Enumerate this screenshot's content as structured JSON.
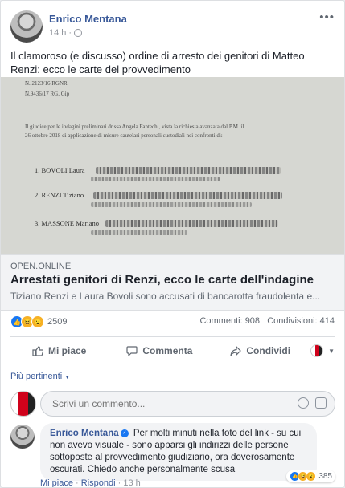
{
  "post": {
    "author": "Enrico Mentana",
    "time": "14 h",
    "more": "•••",
    "text": "Il clamoroso (e discusso) ordine di arresto dei genitori di Matteo Renzi: ecco le carte del provvedimento"
  },
  "document_image": {
    "line1": "N. 2123/16 RGNR",
    "line2": "N.9436/17 RG. Gip",
    "line3": "Il giudice per le indagini preliminari dr.ssa Angela Fantechi, vista la richiesta avanzata dal P.M. il",
    "line4": "26 ottobre 2018 di applicazione di misure cautelari personali custodiali nei confronti di:",
    "name1": "1. BOVOLI Laura",
    "name2": "2. RENZI Tiziano",
    "name3": "3. MASSONE Mariano"
  },
  "link": {
    "domain": "OPEN.ONLINE",
    "title": "Arrestati genitori di Renzi, ecco le carte dell'indagine",
    "description": "Tiziano Renzi e Laura Bovoli sono accusati di bancarotta fraudolenta e..."
  },
  "stats": {
    "reactions": "2509",
    "comments": "Commenti: 908",
    "shares": "Condivisioni: 414"
  },
  "actions": {
    "like": "Mi piace",
    "comment": "Commenta",
    "share": "Condividi"
  },
  "comments_section": {
    "filter": "Più pertinenti",
    "input_placeholder": "Scrivi un commento...",
    "comment": {
      "author": "Enrico Mentana",
      "text": "Per molti minuti nella foto del link - su cui non avevo visuale - sono apparsi gli indirizzi delle persone sottoposte al provvedimento giudiziario, ora doverosamente oscurati. Chiedo anche personalmente scusa",
      "reactions": "385",
      "like": "Mi piace",
      "reply": "Rispondi",
      "time": "13 h"
    }
  },
  "colors": {
    "link_blue": "#385898",
    "like_blue": "#1877f2",
    "reaction_yellow": "#f7b125"
  }
}
